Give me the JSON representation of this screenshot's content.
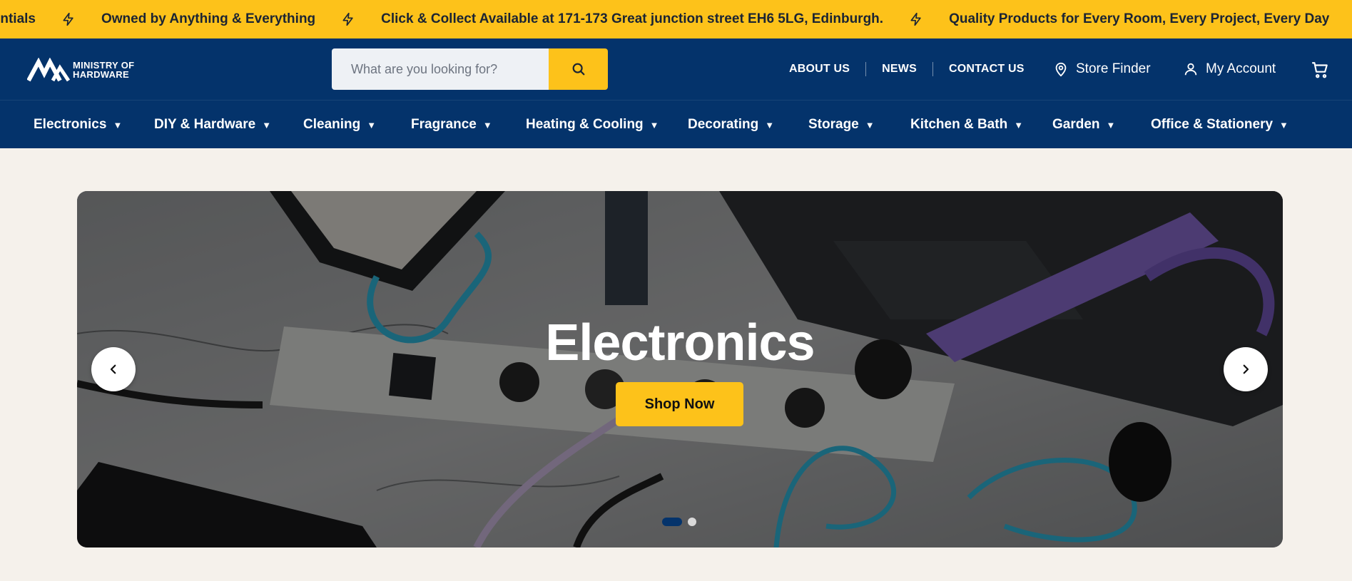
{
  "ticker": {
    "items": [
      "Essentials",
      "Owned by Anything & Everything",
      "Click & Collect Available at 171-173 Great junction street EH6 5LG, Edinburgh.",
      "Quality Products for Every Room, Every Project, Every Day"
    ],
    "accent": "#fdc21a"
  },
  "header": {
    "logo_line1": "MINISTRY OF",
    "logo_line2": "HARDWARE",
    "search_placeholder": "What are you looking for?",
    "links": [
      "ABOUT US",
      "NEWS",
      "CONTACT US"
    ],
    "store_finder": "Store Finder",
    "account": "My Account",
    "icons": [
      "search-icon",
      "map-pin-icon",
      "user-icon",
      "cart-icon"
    ],
    "brand_color": "#04336b"
  },
  "categories": [
    "Electronics",
    "DIY & Hardware",
    "Cleaning",
    "Fragrance",
    "Heating & Cooling",
    "Decorating",
    "Storage",
    "Kitchen & Bath",
    "Garden",
    "Office & Stationery"
  ],
  "hero": {
    "title": "Electronics",
    "button": "Shop Now",
    "slide_count": 2,
    "active_slide": 1
  }
}
